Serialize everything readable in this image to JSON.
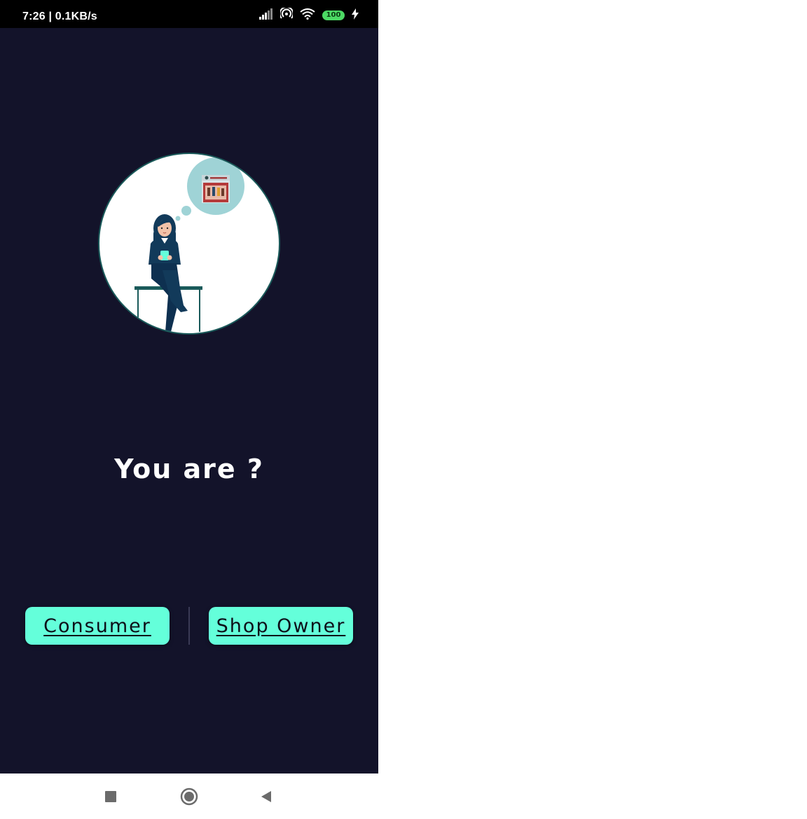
{
  "status_bar": {
    "time_speed": "7:26 | 0.1KB/s",
    "battery_level": "100",
    "icons": [
      "signal-icon",
      "hotspot-icon",
      "wifi-icon",
      "battery-icon",
      "charging-icon"
    ]
  },
  "colors": {
    "background": "#13132a",
    "accent": "#64ffda",
    "circle_fill": "#ffffff",
    "circle_border": "#1a5a5a"
  },
  "main": {
    "question": "You are ?",
    "illustration": "woman-thinking-about-shop-illustration"
  },
  "buttons": {
    "consumer_label": "Consumer",
    "shop_owner_label": "Shop Owner"
  },
  "nav_bar": {
    "icons": [
      "recent-apps-icon",
      "home-icon",
      "back-icon"
    ]
  }
}
